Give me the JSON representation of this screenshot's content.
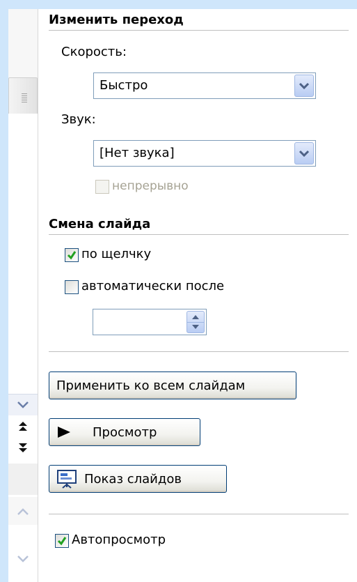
{
  "transition": {
    "title": "Изменить переход",
    "speed_label": "Скорость:",
    "speed_value": "Быстро",
    "sound_label": "Звук:",
    "sound_value": "[Нет звука]",
    "loop_label": "непрерывно",
    "loop_checked": false
  },
  "advance": {
    "title": "Смена слайда",
    "on_click_label": "по щелчку",
    "on_click_checked": true,
    "auto_label": "автоматически после",
    "auto_checked": false,
    "auto_time": ""
  },
  "buttons": {
    "apply_all": "Применить ко всем слайдам",
    "preview": "Просмотр",
    "slideshow": "Показ слайдов"
  },
  "autopreview": {
    "label": "Автопросмотр",
    "checked": true
  },
  "icons": {
    "dropdown": "chevron-down-icon",
    "spinner": "spinner-arrows-icon",
    "play": "play-icon",
    "slideshow": "slideshow-icon",
    "check": "checkmark-icon"
  }
}
